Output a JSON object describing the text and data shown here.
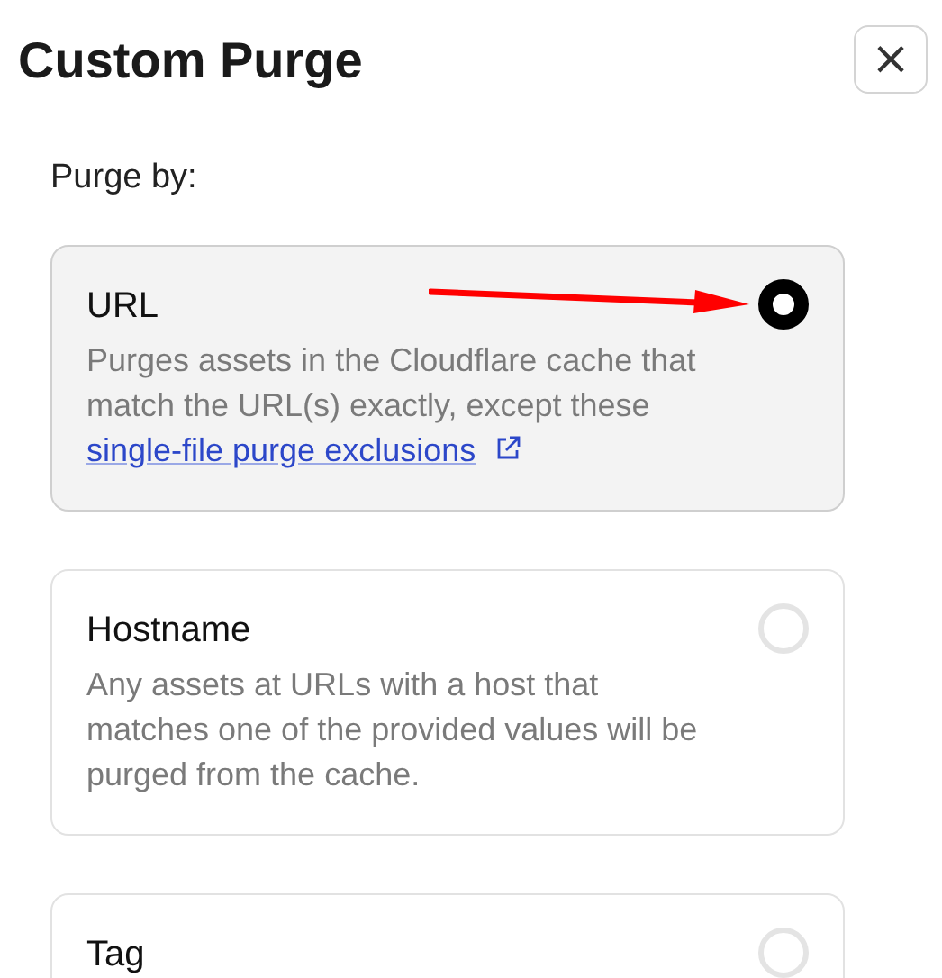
{
  "title": "Custom Purge",
  "close_button": "×",
  "section_label": "Purge by:",
  "options": [
    {
      "label": "URL",
      "selected": true,
      "description": "Purges assets in the Cloudflare cache that match the URL(s) exactly, except these",
      "link": "single-file purge exclusions",
      "arrow_annotation": true
    },
    {
      "label": "Hostname",
      "selected": false,
      "description": "Any assets at URLs with a host that matches one of the provided values will be purged from the cache."
    },
    {
      "label": "Tag",
      "selected": false
    }
  ]
}
